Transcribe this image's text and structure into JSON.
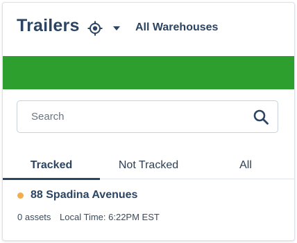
{
  "header": {
    "title": "Trailers",
    "locate_icon": "crosshair-icon",
    "dropdown_icon": "caret-down-icon",
    "warehouse_selector": "All Warehouses"
  },
  "colors": {
    "status_bar": "#2c9f2e",
    "status_dot": "#f2ad4f",
    "accent": "#2b4462"
  },
  "search": {
    "placeholder": "Search",
    "value": "",
    "icon": "search-icon"
  },
  "tabs": [
    {
      "label": "Tracked",
      "active": true
    },
    {
      "label": "Not Tracked",
      "active": false
    },
    {
      "label": "All",
      "active": false
    }
  ],
  "list": {
    "items": [
      {
        "name": "88 Spadina Avenues",
        "assets": "0 assets",
        "local_time": "Local Time: 6:22PM EST"
      }
    ]
  }
}
